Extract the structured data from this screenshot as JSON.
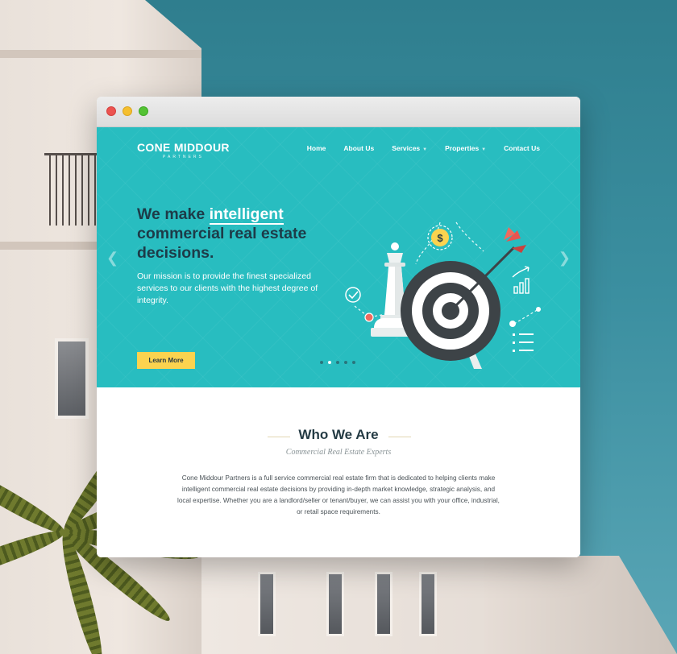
{
  "site": {
    "logo": {
      "name": "CONE MIDDOUR",
      "sub": "PARTNERS"
    },
    "nav": [
      {
        "label": "Home",
        "dropdown": false
      },
      {
        "label": "About Us",
        "dropdown": false
      },
      {
        "label": "Services",
        "dropdown": true
      },
      {
        "label": "Properties",
        "dropdown": true
      },
      {
        "label": "Contact Us",
        "dropdown": false
      }
    ],
    "hero": {
      "title_pre": "We make ",
      "title_highlight": "intelligent",
      "title_post": " commercial real estate decisions.",
      "mission": "Our mission is to provide the finest specialized services to our clients with the highest degree of integrity.",
      "button_label": "Learn More",
      "slides": {
        "count": 5,
        "active": 2
      },
      "dollar_symbol": "$"
    },
    "who": {
      "title": "Who We Are",
      "subtitle": "Commercial Real Estate Experts",
      "body": "Cone Middour Partners is a full service commercial real estate firm that is dedicated to helping clients make intelligent commercial real estate decisions by providing in-depth market knowledge, strategic analysis, and local expertise. Whether you are a landlord/seller or tenant/buyer, we can assist you with your office, industrial, or retail space requirements."
    }
  },
  "colors": {
    "hero_bg": "#28bdc0",
    "title_dark": "#1d3b48",
    "button_yellow": "#fbd34f",
    "target_dark": "#3d4347",
    "arrow_red": "#e85550"
  },
  "icons": {
    "prev": "chevron-left-icon",
    "next": "chevron-right-icon",
    "caret": "chevron-down-icon",
    "check": "check-circle-icon",
    "dollar": "dollar-coin-icon",
    "chart": "bar-chart-icon",
    "list": "checklist-icon"
  }
}
